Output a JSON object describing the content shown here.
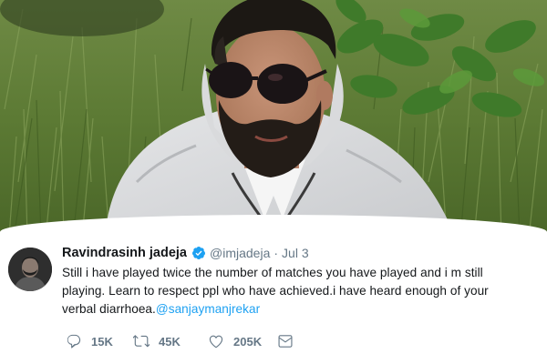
{
  "tweet": {
    "display_name": "Ravindrasinh jadeja",
    "handle": "@imjadeja",
    "separator": "·",
    "date": "Jul 3",
    "text_line1": "Still i have played twice the number of matches you have played and i m still",
    "text_line2": "playing. Learn to respect ppl who have achieved.i have heard enough of your",
    "text_line3_prefix": "verbal diarrhoea.",
    "mention": "@sanjaymanjrekar"
  },
  "actions": {
    "replies": "15K",
    "retweets": "45K",
    "likes": "205K"
  },
  "icons": {
    "verified": "verified-badge-icon",
    "reply": "reply-icon",
    "retweet": "retweet-icon",
    "like": "heart-icon",
    "dm": "direct-message-icon"
  },
  "colors": {
    "accent": "#1da1f2",
    "muted_text": "#657786",
    "main_text": "#14171a"
  }
}
